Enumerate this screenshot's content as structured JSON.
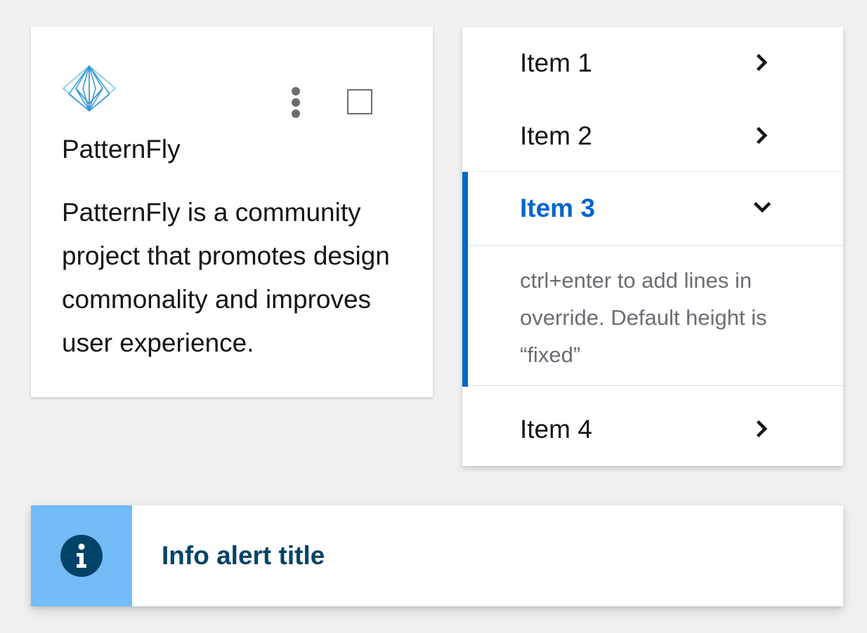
{
  "card": {
    "logo_icon": "patternfly-logo-icon",
    "menu_icon": "kebab-menu-icon",
    "checkbox_checked": false,
    "title": "PatternFly",
    "body": "PatternFly is a community project that promotes design commonality and improves user experience."
  },
  "accordion": {
    "items": [
      {
        "label": "Item 1",
        "expanded": false,
        "icon": "chevron-right-icon"
      },
      {
        "label": "Item 2",
        "expanded": false,
        "icon": "chevron-right-icon"
      },
      {
        "label": "Item 3",
        "expanded": true,
        "icon": "chevron-down-icon",
        "content": "ctrl+enter to add lines in override. Default height is “fixed”"
      },
      {
        "label": "Item 4",
        "expanded": false,
        "icon": "chevron-right-icon"
      }
    ],
    "accent_color": "#0066cc"
  },
  "alert": {
    "variant": "info",
    "icon": "info-circle-icon",
    "title": "Info alert title",
    "icon_bg_color": "#73bcf7",
    "title_color": "#004368"
  }
}
